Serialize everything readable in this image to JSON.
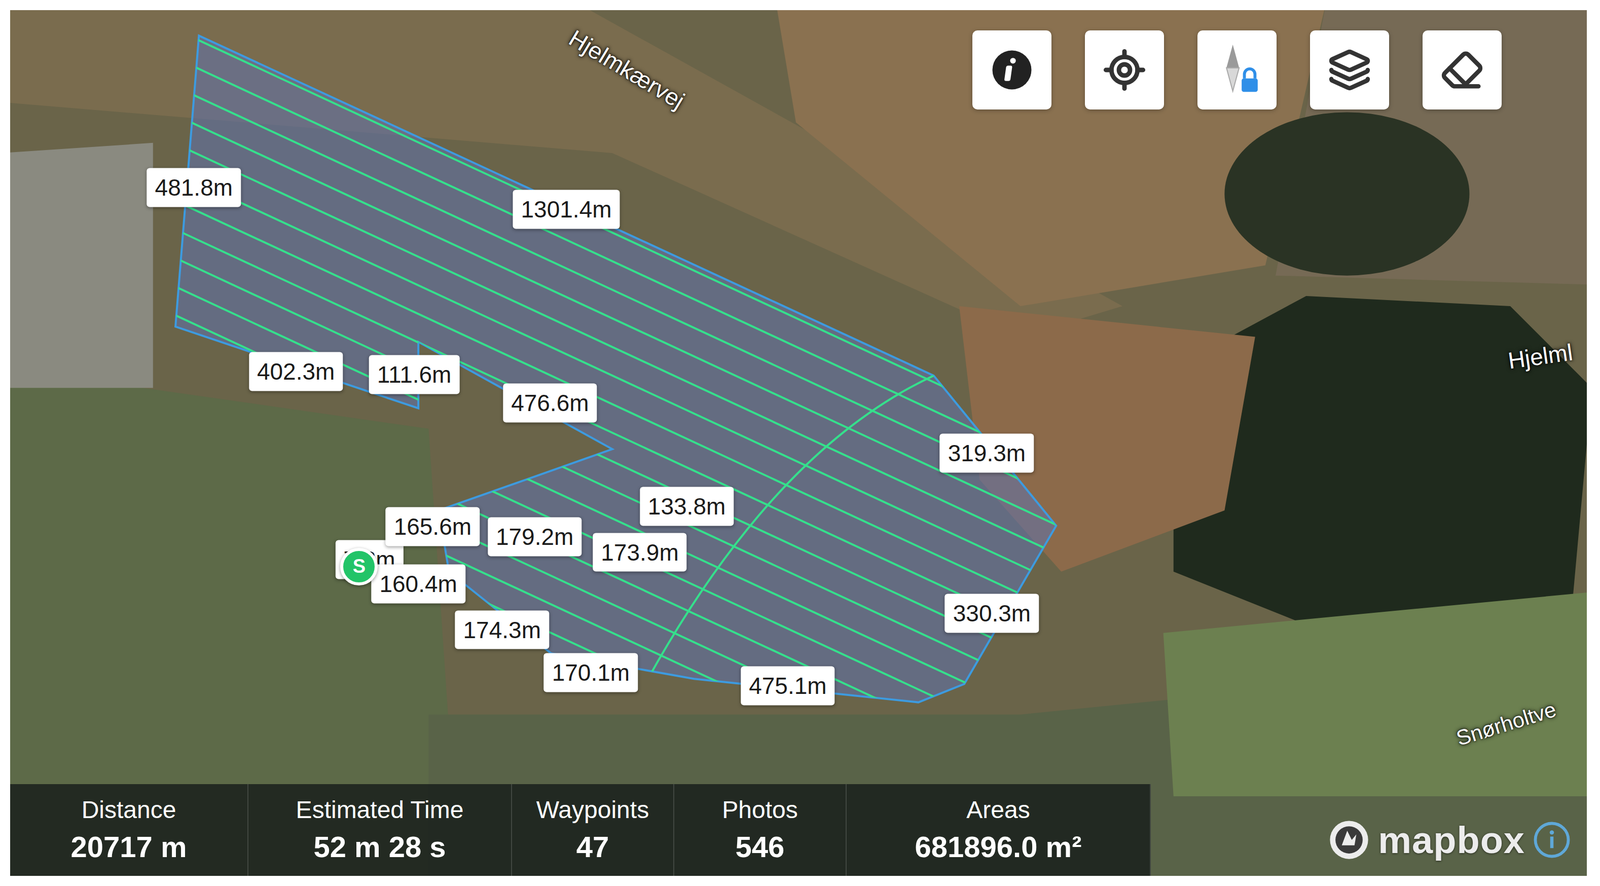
{
  "map": {
    "road_labels": [
      "Hjelmkærvej",
      "Hjelml",
      "Snørholtve"
    ],
    "start_marker": "S",
    "segment_labels": [
      "7.8m",
      "481.8m",
      "1301.4m",
      "402.3m",
      "111.6m",
      "476.6m",
      "319.3m",
      "133.8m",
      "165.6m",
      "179.2m",
      "173.9m",
      "160.4m",
      "174.3m",
      "170.1m",
      "330.3m",
      "475.1m"
    ]
  },
  "toolbar": {
    "compass_locked": true
  },
  "stats": [
    {
      "label": "Distance",
      "value": "20717 m"
    },
    {
      "label": "Estimated Time",
      "value": "52 m 28 s"
    },
    {
      "label": "Waypoints",
      "value": "47"
    },
    {
      "label": "Photos",
      "value": "546"
    },
    {
      "label": "Areas",
      "value": "681896.0 m²"
    }
  ],
  "attribution": {
    "logo": "mapbox"
  }
}
